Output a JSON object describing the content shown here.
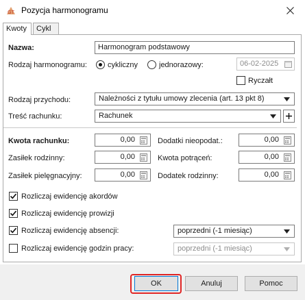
{
  "window": {
    "title": "Pozycja harmonogramu"
  },
  "tabs": [
    {
      "label": "Kwoty",
      "active": true
    },
    {
      "label": "Cykl",
      "active": false
    }
  ],
  "form": {
    "nazwa_label": "Nazwa:",
    "nazwa_value": "Harmonogram podstawowy",
    "rodzaj_harmonogramu_label": "Rodzaj harmonogramu:",
    "radio_cykliczny": "cykliczny",
    "radio_jednorazowy": "jednorazowy:",
    "date_value": "06-02-2025",
    "ryczalt_label": "Ryczałt",
    "rodzaj_przychodu_label": "Rodzaj przychodu:",
    "rodzaj_przychodu_value": "Należności z tytułu umowy zlecenia (art. 13 pkt 8)",
    "tresc_rachunku_label": "Treść rachunku:",
    "tresc_rachunku_value": "Rachunek"
  },
  "amounts": {
    "kwota_rachunku_label": "Kwota rachunku:",
    "kwota_rachunku_value": "0,00",
    "zasilek_rodzinny_label": "Zasiłek rodzinny:",
    "zasilek_rodzinny_value": "0,00",
    "zasilek_pielegnacyjny_label": "Zasiłek pielęgnacyjny:",
    "zasilek_pielegnacyjny_value": "0,00",
    "dodatki_nieopodat_label": "Dodatki nieopodat.:",
    "dodatki_nieopodat_value": "0,00",
    "kwota_potracen_label": "Kwota potrąceń:",
    "kwota_potracen_value": "0,00",
    "dodatek_rodzinny_label": "Dodatek rodzinny:",
    "dodatek_rodzinny_value": "0,00"
  },
  "options": {
    "akordow_label": "Rozliczaj ewidencję akordów",
    "prowizji_label": "Rozliczaj ewidencję prowizji",
    "absencji_label": "Rozliczaj ewidencję absencji:",
    "absencji_value": "poprzedni (-1 miesiąc)",
    "godzin_label": "Rozliczaj ewidencję godzin pracy:",
    "godzin_value": "poprzedni (-1 miesiąc)"
  },
  "buttons": {
    "ok": "OK",
    "cancel": "Anuluj",
    "help": "Pomoc"
  },
  "colors": {
    "highlight": "#e02525",
    "accent": "#0078d7"
  },
  "icons": [
    "app-logo-icon",
    "close-icon",
    "calendar-icon",
    "calculator-icon",
    "chevron-down-icon",
    "plus-icon",
    "checkmark-icon"
  ]
}
